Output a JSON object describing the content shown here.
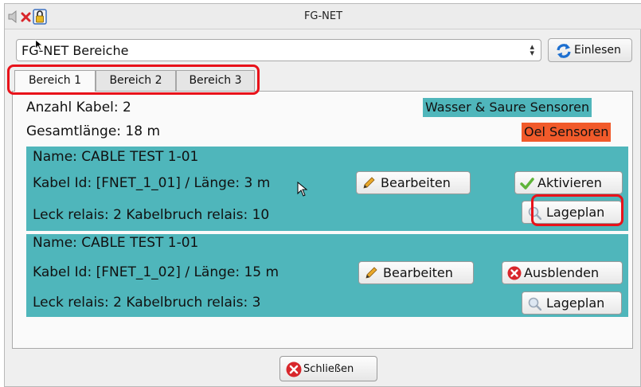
{
  "window": {
    "title": "FG-NET",
    "titlebar_icons": [
      "speaker-muted-icon",
      "close-x-icon",
      "lock-icon"
    ]
  },
  "toolbar": {
    "dropdown_value": "FG-NET Bereiche",
    "refresh_label": "Einlesen"
  },
  "tabs": [
    {
      "label": "Bereich 1",
      "active": true
    },
    {
      "label": "Bereich 2",
      "active": false
    },
    {
      "label": "Bereich 3",
      "active": false
    }
  ],
  "summary": {
    "count": "Anzahl Kabel: 2",
    "length": "Gesamtlänge: 18 m"
  },
  "legend": {
    "water": {
      "label": "Wasser & Saure Sensoren",
      "color": "#4fb6bb"
    },
    "oil": {
      "label": "Oel Sensoren",
      "color": "#f15a2a"
    }
  },
  "cables": [
    {
      "name": "Name: CABLE TEST 1-01",
      "id_line": "Kabel Id: [FNET_1_01] / Länge: 3 m",
      "relais": "Leck relais: 2  Kabelbruch relais: 10",
      "edit_label": "Bearbeiten",
      "toggle_label": "Aktivieren",
      "toggle_icon": "check-icon",
      "map_label": "Lageplan"
    },
    {
      "name": "Name: CABLE TEST 1-01",
      "id_line": "Kabel Id: [FNET_1_02] / Länge: 15 m",
      "relais": "Leck relais: 2  Kabelbruch relais: 3",
      "edit_label": "Bearbeiten",
      "toggle_label": "Ausblenden",
      "toggle_icon": "red-x-icon",
      "map_label": "Lageplan"
    }
  ],
  "footer": {
    "close_label": "Schließen"
  }
}
